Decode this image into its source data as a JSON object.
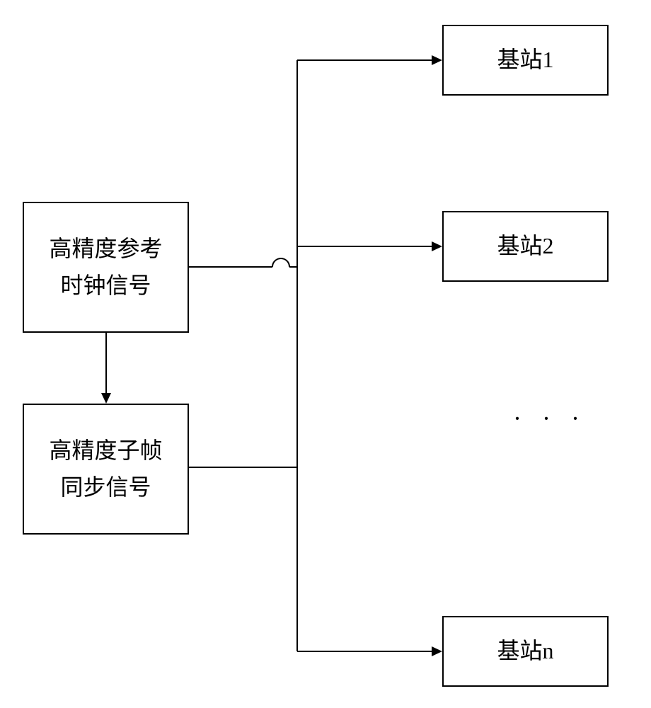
{
  "chart_data": {
    "type": "diagram",
    "title": "",
    "nodes": [
      {
        "id": "clock",
        "label_line1": "高精度参考",
        "label_line2": "时钟信号",
        "meaning": "High-precision reference clock signal"
      },
      {
        "id": "sync",
        "label_line1": "高精度子帧",
        "label_line2": "同步信号",
        "meaning": "High-precision subframe synchronization signal"
      },
      {
        "id": "station1",
        "label": "基站1",
        "meaning": "Base station 1"
      },
      {
        "id": "station2",
        "label": "基站2",
        "meaning": "Base station 2"
      },
      {
        "id": "stationN",
        "label": "基站n",
        "meaning": "Base station n"
      }
    ],
    "ellipsis": "· · ·",
    "edges": [
      {
        "from": "clock",
        "to": "sync"
      },
      {
        "from": "clock",
        "to": "bus"
      },
      {
        "from": "sync",
        "to": "bus"
      },
      {
        "from": "bus",
        "to": "station1"
      },
      {
        "from": "bus",
        "to": "station2"
      },
      {
        "from": "bus",
        "to": "stationN"
      }
    ]
  }
}
